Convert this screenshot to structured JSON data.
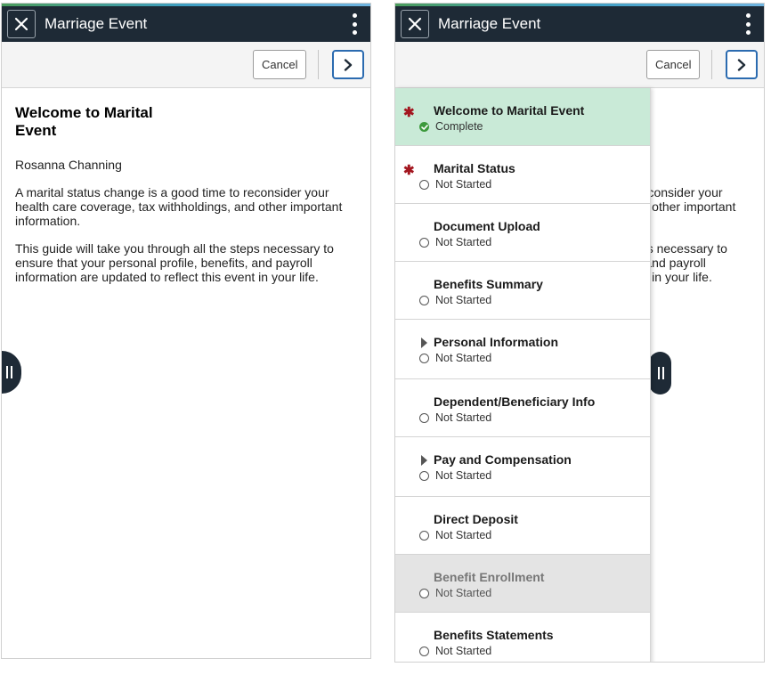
{
  "header": {
    "title": "Marriage Event"
  },
  "toolbar": {
    "cancel_label": "Cancel"
  },
  "content": {
    "heading": "Welcome to Marital Event",
    "name": "Rosanna Channing",
    "paragraph1": "A marital status change is a good time to reconsider your health care coverage, tax withholdings, and other important information.",
    "paragraph2": "This guide will take you through all the steps necessary to ensure that your personal profile, benefits, and payroll information are updated to reflect this event in your life."
  },
  "steps": [
    {
      "label": "Welcome to Marital Event",
      "status": "Complete",
      "required": true,
      "expandable": false,
      "state": "complete"
    },
    {
      "label": "Marital Status",
      "status": "Not Started",
      "required": true,
      "expandable": false,
      "state": "normal"
    },
    {
      "label": "Document Upload",
      "status": "Not Started",
      "required": false,
      "expandable": false,
      "state": "normal"
    },
    {
      "label": "Benefits Summary",
      "status": "Not Started",
      "required": false,
      "expandable": false,
      "state": "normal"
    },
    {
      "label": "Personal Information",
      "status": "Not Started",
      "required": false,
      "expandable": true,
      "state": "normal"
    },
    {
      "label": "Dependent/Beneficiary Info",
      "status": "Not Started",
      "required": false,
      "expandable": false,
      "state": "normal"
    },
    {
      "label": "Pay and Compensation",
      "status": "Not Started",
      "required": false,
      "expandable": true,
      "state": "normal"
    },
    {
      "label": "Direct Deposit",
      "status": "Not Started",
      "required": false,
      "expandable": false,
      "state": "normal"
    },
    {
      "label": "Benefit Enrollment",
      "status": "Not Started",
      "required": false,
      "expandable": false,
      "state": "disabled"
    },
    {
      "label": "Benefits Statements",
      "status": "Not Started",
      "required": false,
      "expandable": false,
      "state": "normal"
    }
  ],
  "colors": {
    "titlebar": "#1e2a36",
    "complete": "#c9ead7",
    "required": "#a3161f",
    "accent": "#2b6bb0"
  },
  "icons": {
    "close": "close-icon",
    "menu": "kebab-menu-icon",
    "next": "chevron-right-icon",
    "handle": "panel-handle-icon"
  }
}
